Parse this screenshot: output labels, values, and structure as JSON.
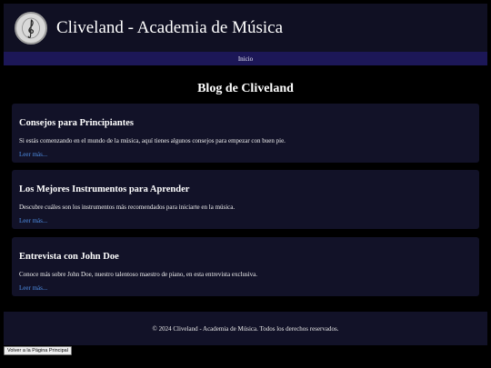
{
  "header": {
    "title": "Cliveland - Academia de Música",
    "logo_icon": "treble-clef-icon"
  },
  "nav": {
    "items": [
      {
        "label": "Inicio"
      }
    ]
  },
  "main": {
    "heading": "Blog de Cliveland",
    "posts": [
      {
        "title": "Consejos para Principiantes",
        "excerpt": "Si estás comenzando en el mundo de la música, aquí tienes algunos consejos para empezar con buen pie.",
        "link": "Leer más..."
      },
      {
        "title": "Los Mejores Instrumentos para Aprender",
        "excerpt": "Descubre cuáles son los instrumentos más recomendados para iniciarte en la música.",
        "link": "Leer más..."
      },
      {
        "title": "Entrevista con John Doe",
        "excerpt": "Conoce más sobre John Doe, nuestro talentoso maestro de piano, en esta entrevista exclusiva.",
        "link": "Leer más..."
      }
    ]
  },
  "footer": {
    "text": "© 2024 Cliveland - Academia de Música. Todos los derechos reservados."
  },
  "back_button": {
    "label": "Volver a la Página Principal"
  },
  "colors": {
    "background": "#000000",
    "header_bg": "#101023",
    "nav_bg": "#1c1757",
    "card_bg": "#121228",
    "link": "#4f8fe6"
  }
}
